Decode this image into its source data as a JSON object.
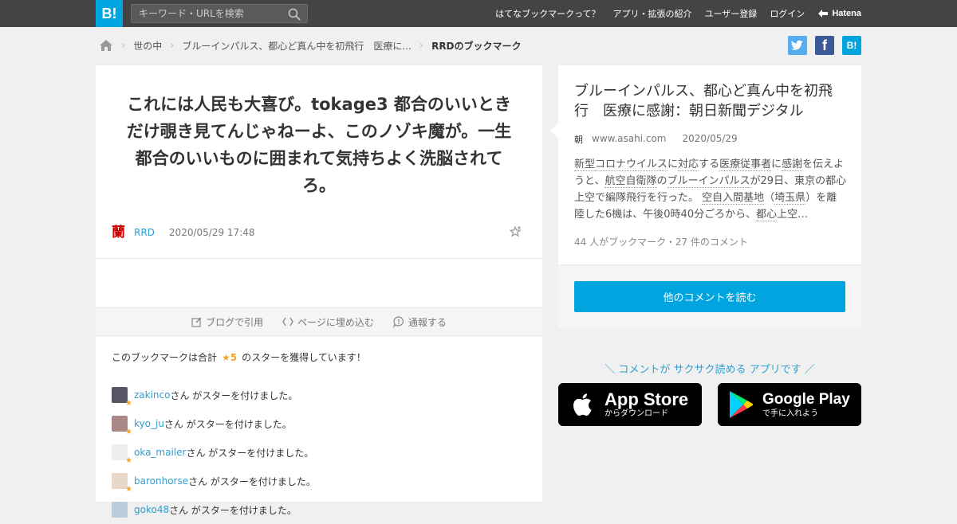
{
  "header": {
    "logo": "B!",
    "search_placeholder": "キーワード・URLを検索",
    "nav": [
      "はてなブックマークって？",
      "アプリ・拡張の紹介",
      "ユーザー登録",
      "ログイン"
    ],
    "brand": "Hatena"
  },
  "breadcrumb": {
    "items": [
      "世の中",
      "ブルーインパルス、都心ど真ん中を初飛行　医療に..."
    ],
    "current": "RRDのブックマーク"
  },
  "share": {
    "facebook": "f",
    "hatena": "B!"
  },
  "bookmark": {
    "comment": "これには人民も大喜び。tokage3 都合のいいときだけ覗き見てんじゃねーよ、このノゾキ魔が。一生都合のいいものに囲まれて気持ちよく洗脳されてろ。",
    "avatar": "蘭",
    "user": "RRD",
    "date": "2020/05/29 17:48"
  },
  "actions": [
    "ブログで引用",
    "ページに埋め込む",
    "通報する"
  ],
  "stars": {
    "prefix": "このブックマークは合計",
    "count": "★5",
    "suffix": "のスターを獲得しています！"
  },
  "stargivers": [
    {
      "user": "zakinco",
      "text": "さん がスターを付けました。"
    },
    {
      "user": "kyo_ju",
      "text": "さん がスターを付けました。"
    },
    {
      "user": "oka_mailer",
      "text": "さん がスターを付けました。"
    },
    {
      "user": "baronhorse",
      "text": "さん がスターを付けました。"
    },
    {
      "user": "goko48",
      "text": "さん がスターを付けました。"
    }
  ],
  "entry": {
    "title": "ブルーインパルス、都心ど真ん中を初飛行　医療に感謝：朝日新聞デジタル",
    "favicon": "朝",
    "domain": "www.asahi.com",
    "date": "2020/05/29",
    "desc": [
      "新型",
      "コロナウイルス",
      "に",
      "対応",
      "する",
      "医療従事者",
      "に",
      "感謝",
      "を伝えようと、",
      "航空自衛隊",
      "の",
      "ブルーインパルス",
      "が29日、東京の都心上空で編隊飛行を行った。 ",
      "空自入間基地",
      "（",
      "埼玉県",
      "）を離陸した6機は、午後0時40分ごろから、",
      "都心",
      "上空…"
    ],
    "count": "44 人がブックマーク・27 件のコメント",
    "button": "他のコメントを読む"
  },
  "promo": "＼ コメントが サクサク読める アプリです ／",
  "appstore": {
    "big": "App Store",
    "small": "からダウンロード"
  },
  "googleplay": {
    "big": "Google Play",
    "small": "で手に入れよう"
  }
}
